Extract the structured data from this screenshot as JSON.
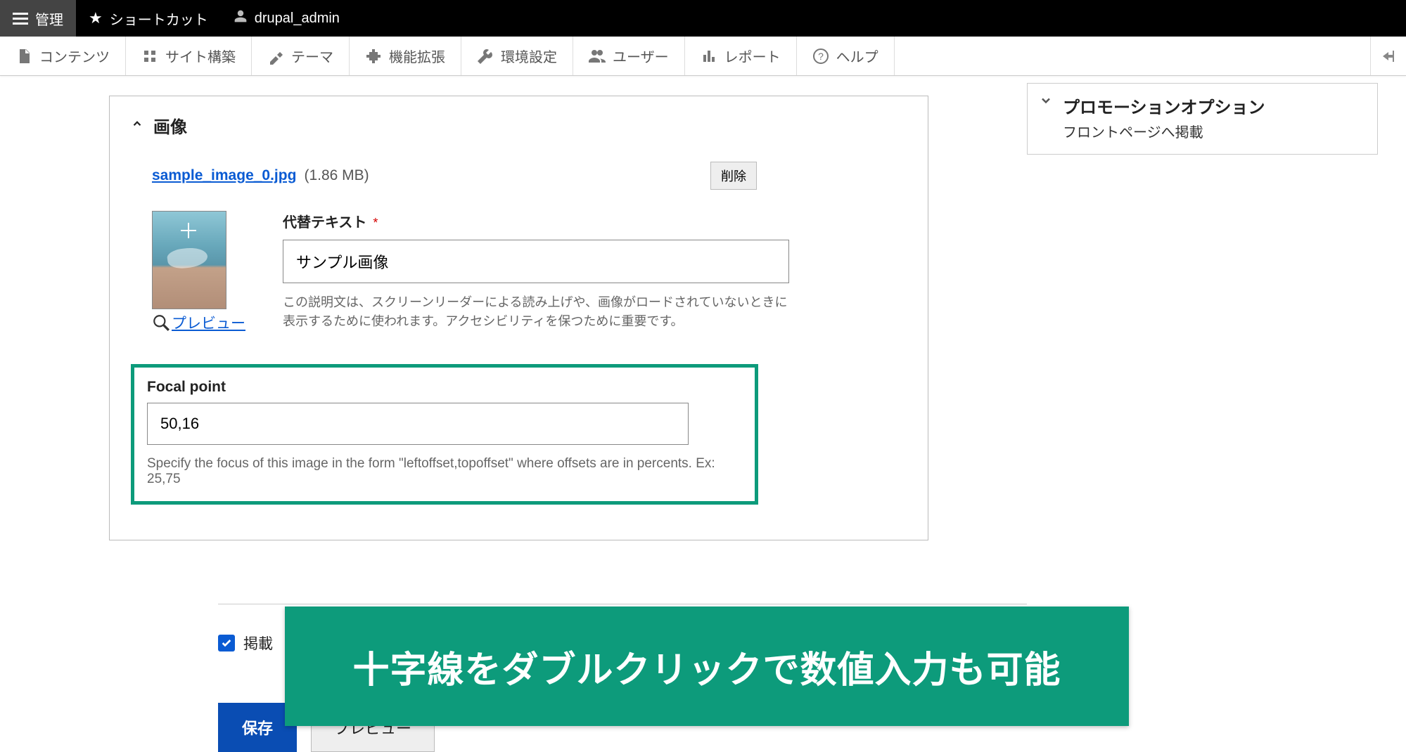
{
  "topbar": {
    "manage": "管理",
    "shortcuts": "ショートカット",
    "user": "drupal_admin"
  },
  "nav": {
    "content": "コンテンツ",
    "structure": "サイト構築",
    "appearance": "テーマ",
    "extend": "機能拡張",
    "config": "環境設定",
    "people": "ユーザー",
    "reports": "レポート",
    "help": "ヘルプ"
  },
  "sidebar": {
    "promo": {
      "title": "プロモーションオプション",
      "sub": "フロントページへ掲載"
    }
  },
  "image_panel": {
    "heading": "画像",
    "filename": "sample_image_0.jpg",
    "filesize": "(1.86 MB)",
    "remove": "削除",
    "preview": "プレビュー",
    "alt_label": "代替テキスト",
    "alt_value": "サンプル画像",
    "alt_help": "この説明文は、スクリーンリーダーによる読み上げや、画像がロードされていないときに表示するために使われます。アクセシビリティを保つために重要です。",
    "focal_label": "Focal point",
    "focal_value": "50,16",
    "focal_help": "Specify the focus of this image in the form \"leftoffset,topoffset\" where offsets are in percents. Ex: 25,75"
  },
  "annotation": "十字線をダブルクリックで数値入力も可能",
  "footer": {
    "published": "掲載",
    "save": "保存",
    "preview": "プレビュー"
  }
}
